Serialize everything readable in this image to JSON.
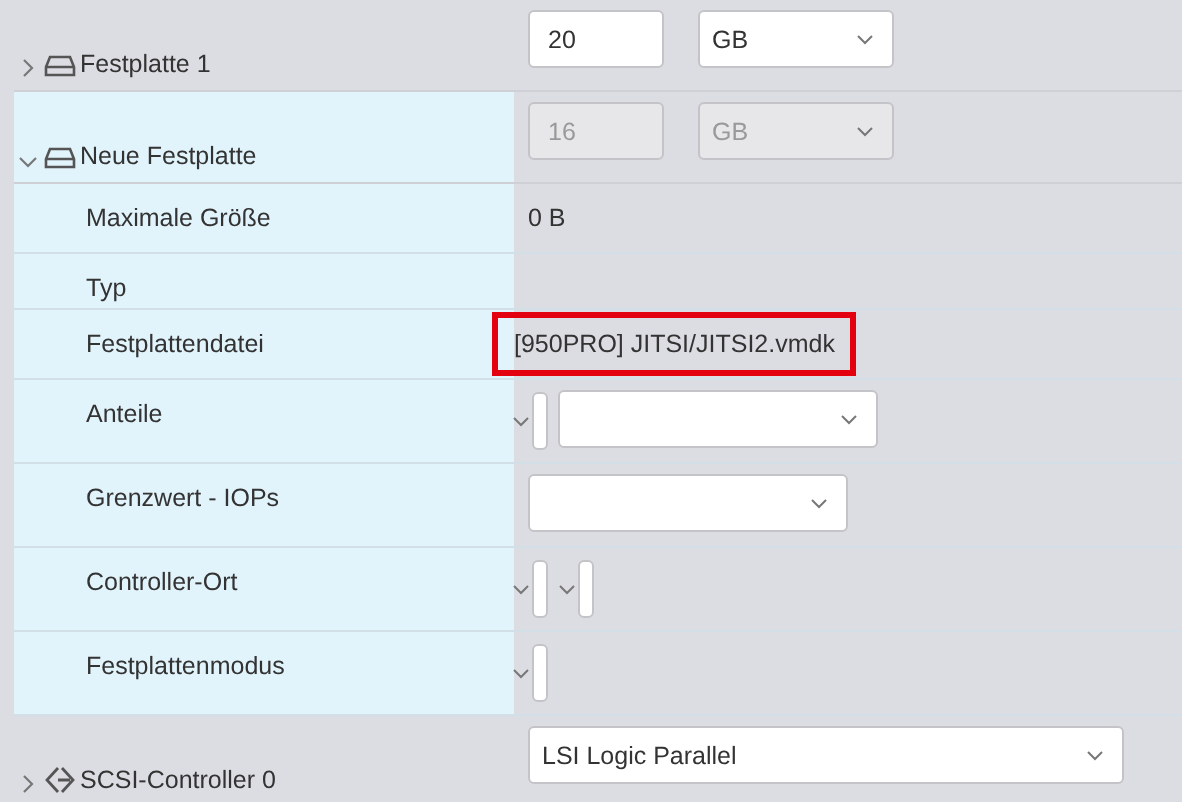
{
  "rows": [
    {
      "label": "Festplatte 1",
      "kind": "disk",
      "expanded": false,
      "controls": [
        {
          "kind": "input",
          "value": "20",
          "disabled": false
        },
        {
          "kind": "unit-select",
          "value": "GB",
          "disabled": false
        }
      ]
    },
    {
      "label": "Neue Festplatte",
      "kind": "disk",
      "expanded": true,
      "controls": [
        {
          "kind": "input",
          "value": "16",
          "disabled": true
        },
        {
          "kind": "unit-select",
          "value": "GB",
          "disabled": true
        }
      ],
      "children": [
        {
          "label": "Maximale Größe",
          "controls": [
            {
              "kind": "text",
              "value": "0 B",
              "highlighted": false
            }
          ]
        },
        {
          "label": "Typ"
        },
        {
          "label": "Festplattendatei",
          "controls": [
            {
              "kind": "text",
              "value": "[950PRO] JITSI/JITSI2.vmdk",
              "highlighted": true
            }
          ]
        },
        {
          "label": "Anteile",
          "controls": [
            {
              "kind": "stub-select"
            },
            {
              "kind": "select"
            }
          ]
        },
        {
          "label": "Grenzwert - IOPs",
          "controls": [
            {
              "kind": "select"
            }
          ]
        },
        {
          "label": "Controller-Ort",
          "controls": [
            {
              "kind": "stub-select"
            },
            {
              "kind": "stub-select"
            }
          ]
        },
        {
          "label": "Festplattenmodus",
          "controls": [
            {
              "kind": "stub-select"
            }
          ]
        }
      ]
    },
    {
      "label": "SCSI-Controller 0",
      "kind": "controller",
      "expanded": false,
      "controls": [
        {
          "kind": "wide-select",
          "value": "LSI Logic Parallel",
          "disabled": false
        }
      ]
    }
  ]
}
